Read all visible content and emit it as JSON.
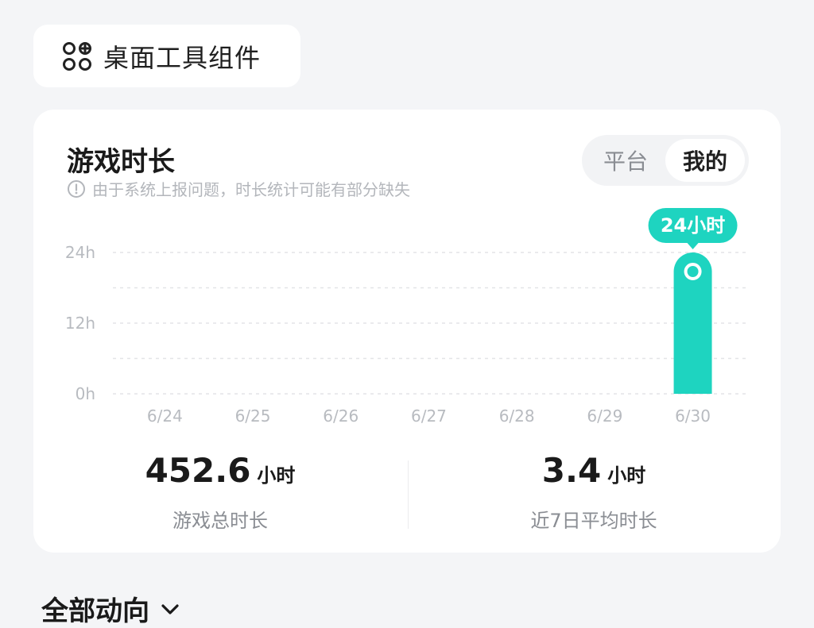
{
  "widget_button": {
    "label": "桌面工具组件",
    "icon": "grid-add-icon"
  },
  "card": {
    "title": "游戏时长",
    "notice": "由于系统上报问题，时长统计可能有部分缺失",
    "notice_icon": "info-icon",
    "toggle": {
      "options": [
        "平台",
        "我的"
      ],
      "selected": "我的"
    }
  },
  "chart_data": {
    "type": "bar",
    "categories": [
      "6/24",
      "6/25",
      "6/26",
      "6/27",
      "6/28",
      "6/29",
      "6/30"
    ],
    "values": [
      0,
      0,
      0,
      0,
      0,
      0,
      24
    ],
    "y_ticks": [
      "0h",
      "12h",
      "24h"
    ],
    "ylim": [
      0,
      24
    ],
    "grid": true,
    "highlight": {
      "index": 6,
      "label": "24小时"
    },
    "bar_color": "#1ed4c0"
  },
  "stats": {
    "total": {
      "value": "452.6",
      "unit": "小时",
      "caption": "游戏总时长"
    },
    "average": {
      "value": "3.4",
      "unit": "小时",
      "caption": "近7日平均时长"
    }
  },
  "feed": {
    "title": "全部动向",
    "icon": "chevron-down-icon"
  }
}
